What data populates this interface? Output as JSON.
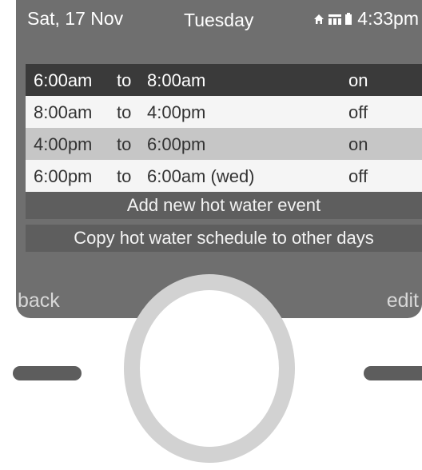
{
  "status_bar": {
    "date": "Sat, 17 Nov",
    "day": "Tuesday",
    "time": "4:33pm",
    "icons": [
      "home-icon",
      "signal-icon",
      "battery-icon"
    ]
  },
  "schedule": {
    "rows": [
      {
        "from": "6:00am",
        "to_word": "to",
        "till": "8:00am",
        "state": "on"
      },
      {
        "from": "8:00am",
        "to_word": "to",
        "till": "4:00pm",
        "state": "off"
      },
      {
        "from": "4:00pm",
        "to_word": "to",
        "till": "6:00pm",
        "state": "on"
      },
      {
        "from": "6:00pm",
        "to_word": "to",
        "till": "6:00am (wed)",
        "state": "off"
      }
    ]
  },
  "actions": {
    "add_label": "Add new hot water event",
    "copy_label": "Copy hot water schedule to other days"
  },
  "softkeys": {
    "back_label": "back",
    "edit_label": "edit"
  },
  "colors": {
    "screen_bg": "#6f6f6f",
    "selected_row": "#3a3a3a",
    "light_row": "#f5f5f5",
    "mid_row": "#c6c6c6",
    "action_bg": "#5e5e5e"
  }
}
